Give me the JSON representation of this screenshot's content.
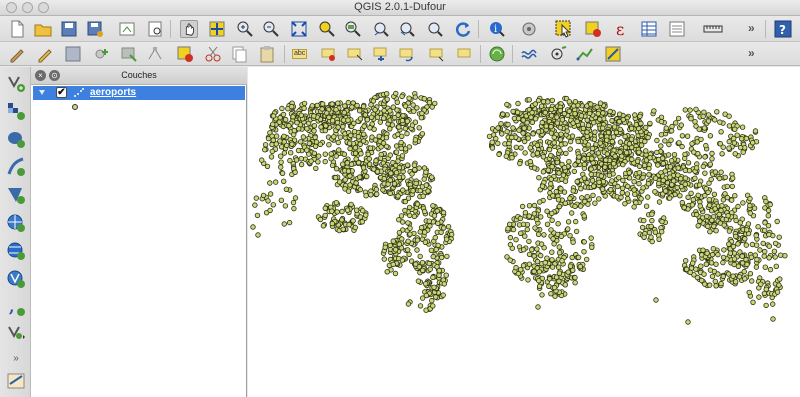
{
  "window": {
    "title": "QGIS 2.0.1-Dufour"
  },
  "toolbar_main": {
    "icons": [
      "new-project-icon",
      "open-project-icon",
      "save-project-icon",
      "save-as-icon",
      "print-composer-icon",
      "composer-manager-icon",
      "pan-hand-icon",
      "pan-to-selection-icon",
      "zoom-in-icon",
      "zoom-out-icon",
      "zoom-full-icon",
      "zoom-selection-icon",
      "zoom-layer-icon",
      "zoom-last-icon",
      "zoom-next-icon",
      "refresh-icon",
      "identify-icon",
      "action-icon",
      "select-features-icon",
      "deselect-icon",
      "expression-select-icon",
      "attribute-table-icon",
      "statistics-icon",
      "measure-icon",
      "help-icon"
    ],
    "overflow_label": "»"
  },
  "toolbar_edit": {
    "icons": [
      "current-edits-icon",
      "toggle-edit-icon",
      "save-edits-icon",
      "add-feature-icon",
      "move-feature-icon",
      "node-tool-icon",
      "delete-selected-icon",
      "cut-features-icon",
      "copy-features-icon",
      "paste-features-icon",
      "label-icon",
      "pin-label-icon",
      "highlight-label-icon",
      "move-label-icon",
      "rotate-label-icon",
      "change-label-icon",
      "gps-icon",
      "trace-icon",
      "snapping-icon",
      "digitize-icon",
      "python-icon"
    ],
    "overflow_label": "»",
    "label_badge": "abc"
  },
  "left_toolbar": {
    "icons": [
      "add-vector-layer-icon",
      "add-raster-layer-icon",
      "add-postgis-layer-icon",
      "add-spatialite-layer-icon",
      "add-mssql-layer-icon",
      "add-wms-layer-icon",
      "add-wcs-layer-icon",
      "add-wfs-layer-icon",
      "add-delimited-text-icon",
      "new-shapefile-icon",
      "more-icon",
      "gps-panel-icon"
    ]
  },
  "layers_panel": {
    "title": "Couches",
    "close_label": "×",
    "float_label": "⊙",
    "layers": [
      {
        "name": "aeroports",
        "checked": true,
        "check_mark": "✔",
        "type": "point",
        "symbol_color": "#c9d67a"
      }
    ]
  },
  "map": {
    "background": "#ffffff",
    "point_fill": "#c9d67a",
    "point_stroke": "#2e2e14",
    "layer": "aeroports"
  }
}
